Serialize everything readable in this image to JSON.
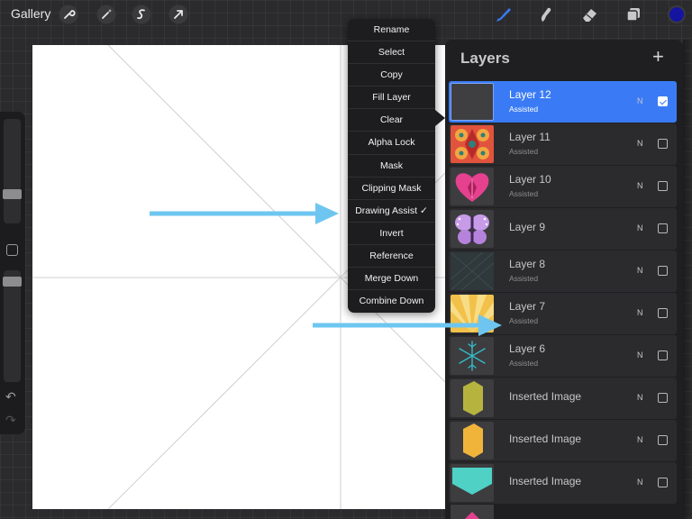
{
  "toolbar": {
    "gallery_label": "Gallery",
    "left_icons": [
      "wrench-icon",
      "magic-wand-icon",
      "selection-s-icon",
      "transform-arrow-icon"
    ],
    "right_icons": [
      "brush-icon",
      "smudge-icon",
      "eraser-icon",
      "layers-icon"
    ],
    "current_color": "#1414a0",
    "accent_color": "#3a7bf5"
  },
  "context_menu": {
    "items": [
      "Rename",
      "Select",
      "Copy",
      "Fill Layer",
      "Clear",
      "Alpha Lock",
      "Mask",
      "Clipping Mask",
      "Drawing Assist ✓",
      "Invert",
      "Reference",
      "Merge Down",
      "Combine Down"
    ]
  },
  "layers": {
    "title": "Layers",
    "add_label": "+",
    "items": [
      {
        "name": "Layer 12",
        "sub": "Assisted",
        "blend": "N",
        "visible": true,
        "selected": true
      },
      {
        "name": "Layer 11",
        "sub": "Assisted",
        "blend": "N",
        "visible": false
      },
      {
        "name": "Layer 10",
        "sub": "Assisted",
        "blend": "N",
        "visible": false
      },
      {
        "name": "Layer 9",
        "sub": "",
        "blend": "N",
        "visible": false
      },
      {
        "name": "Layer 8",
        "sub": "Assisted",
        "blend": "N",
        "visible": false
      },
      {
        "name": "Layer 7",
        "sub": "Assisted",
        "blend": "N",
        "visible": false
      },
      {
        "name": "Layer 6",
        "sub": "Assisted",
        "blend": "N",
        "visible": false
      },
      {
        "name": "Inserted Image",
        "sub": "",
        "blend": "N",
        "visible": false
      },
      {
        "name": "Inserted Image",
        "sub": "",
        "blend": "N",
        "visible": false
      },
      {
        "name": "Inserted Image",
        "sub": "",
        "blend": "N",
        "visible": false
      }
    ]
  },
  "annotation_color": "#6ec6f0"
}
